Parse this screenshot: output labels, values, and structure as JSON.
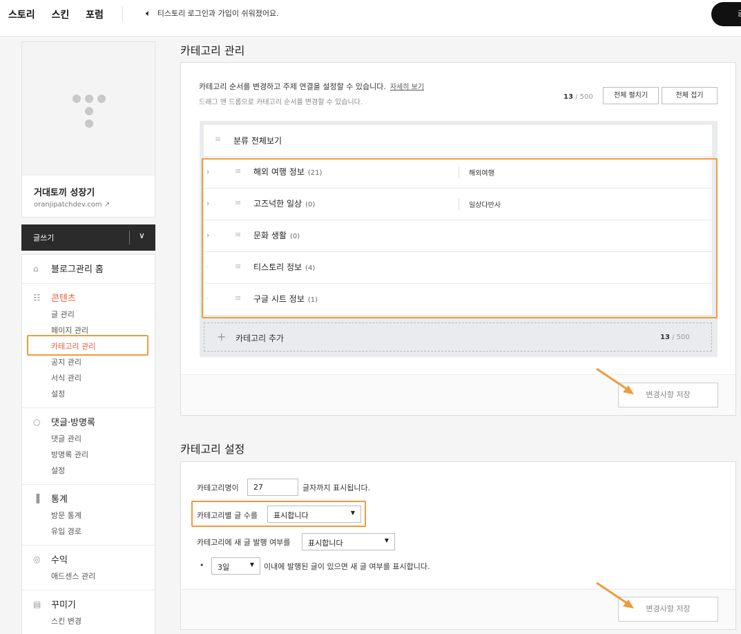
{
  "topbar": {
    "nav": [
      "스토리",
      "스킨",
      "포럼"
    ],
    "notice": "티스토리 로그인과 가입이 쉬워졌어요.",
    "right_button": "글"
  },
  "sidebar": {
    "blog_name": "거대토끼 성장기",
    "blog_url": "oranjipatchdev.com",
    "write_label": "글쓰기",
    "sections": [
      {
        "title": "블로그관리 홈",
        "icon": "home-icon",
        "items": []
      },
      {
        "title": "콘텐츠",
        "icon": "document-icon",
        "items": [
          "글 관리",
          "페이지 관리",
          "카테고리 관리",
          "공지 관리",
          "서식 관리",
          "설정"
        ]
      },
      {
        "title": "댓글·방명록",
        "icon": "speech-bubble-icon",
        "items": [
          "댓글 관리",
          "방명록 관리",
          "설정"
        ]
      },
      {
        "title": "통계",
        "icon": "bar-chart-icon",
        "items": [
          "방문 통계",
          "유입 경로"
        ]
      },
      {
        "title": "수익",
        "icon": "coin-icon",
        "items": [
          "애드센스 관리"
        ]
      },
      {
        "title": "꾸미기",
        "icon": "layout-icon",
        "items": [
          "스킨 변경"
        ]
      }
    ]
  },
  "category_manage": {
    "title": "카테고리 관리",
    "description": "카테고리 순서를 변경하고 주제 연결을 설정할 수 있습니다.",
    "help_link": "자세히 보기",
    "sub_description": "드래그 앤 드롭으로 카테고리 순서를 변경할 수 있습니다.",
    "count": "13",
    "max": "/ 500",
    "expand_all": "전체 펼치기",
    "collapse_all": "전체 접기",
    "root_label": "분류 전체보기",
    "categories": [
      {
        "name": "해외 여행 정보",
        "count": "(21)",
        "topic": "해외여행",
        "expand": "›"
      },
      {
        "name": "고즈넉한 일상",
        "count": "(0)",
        "topic": "일상다반사",
        "expand": "›"
      },
      {
        "name": "문화 생활",
        "count": "(0)",
        "topic": "",
        "expand": "›"
      },
      {
        "name": "티스토리 정보",
        "count": "(4)",
        "topic": "",
        "expand": "·"
      },
      {
        "name": "구글 시트 정보",
        "count": "(1)",
        "topic": "",
        "expand": "·"
      }
    ],
    "add_label": "카테고리 추가",
    "save_label": "변경사항 저장"
  },
  "category_settings": {
    "title": "카테고리 설정",
    "name_label": "카테고리명이",
    "name_value": "27",
    "name_suffix": "글자까지 표시됩니다.",
    "count_label": "카테고리별 글 수를",
    "count_value": "표시합니다",
    "new_label": "카테고리에 새 글 발행 여부를",
    "new_value": "표시합니다",
    "days_value": "3일",
    "days_suffix": "이내에 발행된 글이 있으면 새 글 여부를 표시합니다.",
    "bullet": "•",
    "save_label": "변경사항 저장"
  },
  "highlight_color": "#ef9a3c",
  "accent_color": "#ee5a3a"
}
